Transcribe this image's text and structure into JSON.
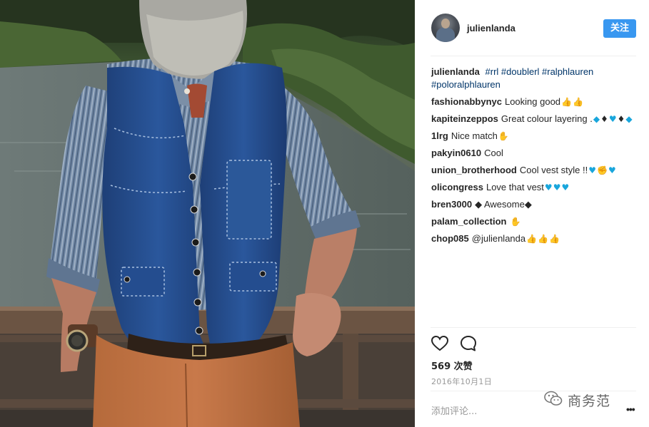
{
  "post": {
    "author": "julienlanda",
    "follow_label": "关注",
    "caption": {
      "user": "julienlanda",
      "text": "#rrl #doublerl #ralphlauren #poloralphlauren"
    },
    "comments": [
      {
        "user": "fashionabbynyc",
        "text": "Looking good",
        "emoji": [
          {
            "g": "👍",
            "c": "e-thumb"
          },
          {
            "g": "👍",
            "c": "e-thumb"
          }
        ]
      },
      {
        "user": "kapiteinzeppos",
        "text": "Great colour layering .",
        "emoji": [
          {
            "g": "◆",
            "c": "e-diam"
          },
          {
            "g": "♦",
            "c": "e-black"
          },
          {
            "g": "♥",
            "c": "e-heart"
          },
          {
            "g": "♦",
            "c": "e-black"
          },
          {
            "g": "◆",
            "c": "e-diam"
          }
        ]
      },
      {
        "user": "1lrg",
        "text": "Nice match",
        "emoji": [
          {
            "g": "✋",
            "c": "e-hand"
          }
        ]
      },
      {
        "user": "pakyin0610",
        "text": "Cool",
        "emoji": []
      },
      {
        "user": "union_brotherhood",
        "text": "Cool vest style !!",
        "emoji": [
          {
            "g": "♥",
            "c": "e-heart"
          },
          {
            "g": "✊",
            "c": "e-hand"
          },
          {
            "g": "♥",
            "c": "e-heart"
          }
        ]
      },
      {
        "user": "olicongress",
        "text": "Love that vest",
        "emoji": [
          {
            "g": "♥",
            "c": "e-heart"
          },
          {
            "g": "♥",
            "c": "e-heart"
          },
          {
            "g": "♥",
            "c": "e-heart"
          }
        ]
      },
      {
        "user": "bren3000",
        "text": "◆ Awesome◆",
        "emoji": []
      },
      {
        "user": "palam_collection",
        "text": "",
        "emoji": [
          {
            "g": "✋",
            "c": "e-hand"
          }
        ]
      },
      {
        "user": "chop085",
        "text": "@julienlanda",
        "emoji": [
          {
            "g": "👍",
            "c": "e-thumb"
          },
          {
            "g": "👍",
            "c": "e-thumb"
          },
          {
            "g": "👍",
            "c": "e-thumb"
          }
        ]
      }
    ],
    "likes": "569 次赞",
    "date": "2016年10月1日",
    "add_comment_placeholder": "添加评论...",
    "more_icon": "more-icon",
    "like_icon": "heart-outline-icon",
    "comment_icon": "speech-bubble-icon",
    "watermark": "商务范",
    "colors": {
      "accent": "#3897f0",
      "text": "#262626",
      "hashtag": "#003569",
      "muted": "#999999"
    }
  }
}
